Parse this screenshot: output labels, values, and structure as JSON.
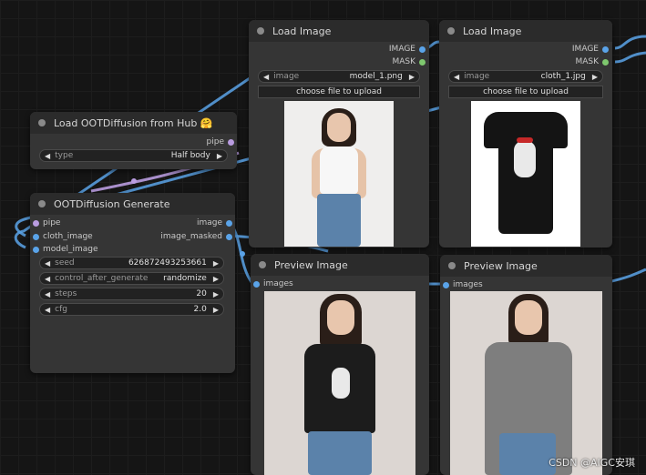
{
  "nodes": {
    "load_image_1": {
      "title": "Load Image",
      "outputs": [
        "IMAGE",
        "MASK"
      ],
      "image_label": "image",
      "image_value": "model_1.png",
      "upload_label": "choose file to upload"
    },
    "load_image_2": {
      "title": "Load Image",
      "outputs": [
        "IMAGE",
        "MASK"
      ],
      "image_label": "image",
      "image_value": "cloth_1.jpg",
      "upload_label": "choose file to upload"
    },
    "load_oot": {
      "title": "Load OOTDiffusion from Hub 🤗",
      "output": "pipe",
      "type_label": "type",
      "type_value": "Half body"
    },
    "generate": {
      "title": "OOTDiffusion Generate",
      "inputs": [
        "pipe",
        "cloth_image",
        "model_image"
      ],
      "outputs": [
        "image",
        "image_masked"
      ],
      "widgets": [
        {
          "label": "seed",
          "value": "626872493253661"
        },
        {
          "label": "control_after_generate",
          "value": "randomize"
        },
        {
          "label": "steps",
          "value": "20"
        },
        {
          "label": "cfg",
          "value": "2.0"
        }
      ]
    },
    "preview_1": {
      "title": "Preview Image",
      "input": "images"
    },
    "preview_2": {
      "title": "Preview Image",
      "input": "images"
    }
  },
  "watermark": "CSDN @AIGC安琪",
  "colors": {
    "canvas_bg": "#151515",
    "node_bg": "#353535",
    "node_title_bg": "#2b2b2b",
    "wire_image": "#5aa3e8",
    "wire_pipe": "#b99ce0",
    "slot_mask": "#7ec76e"
  }
}
